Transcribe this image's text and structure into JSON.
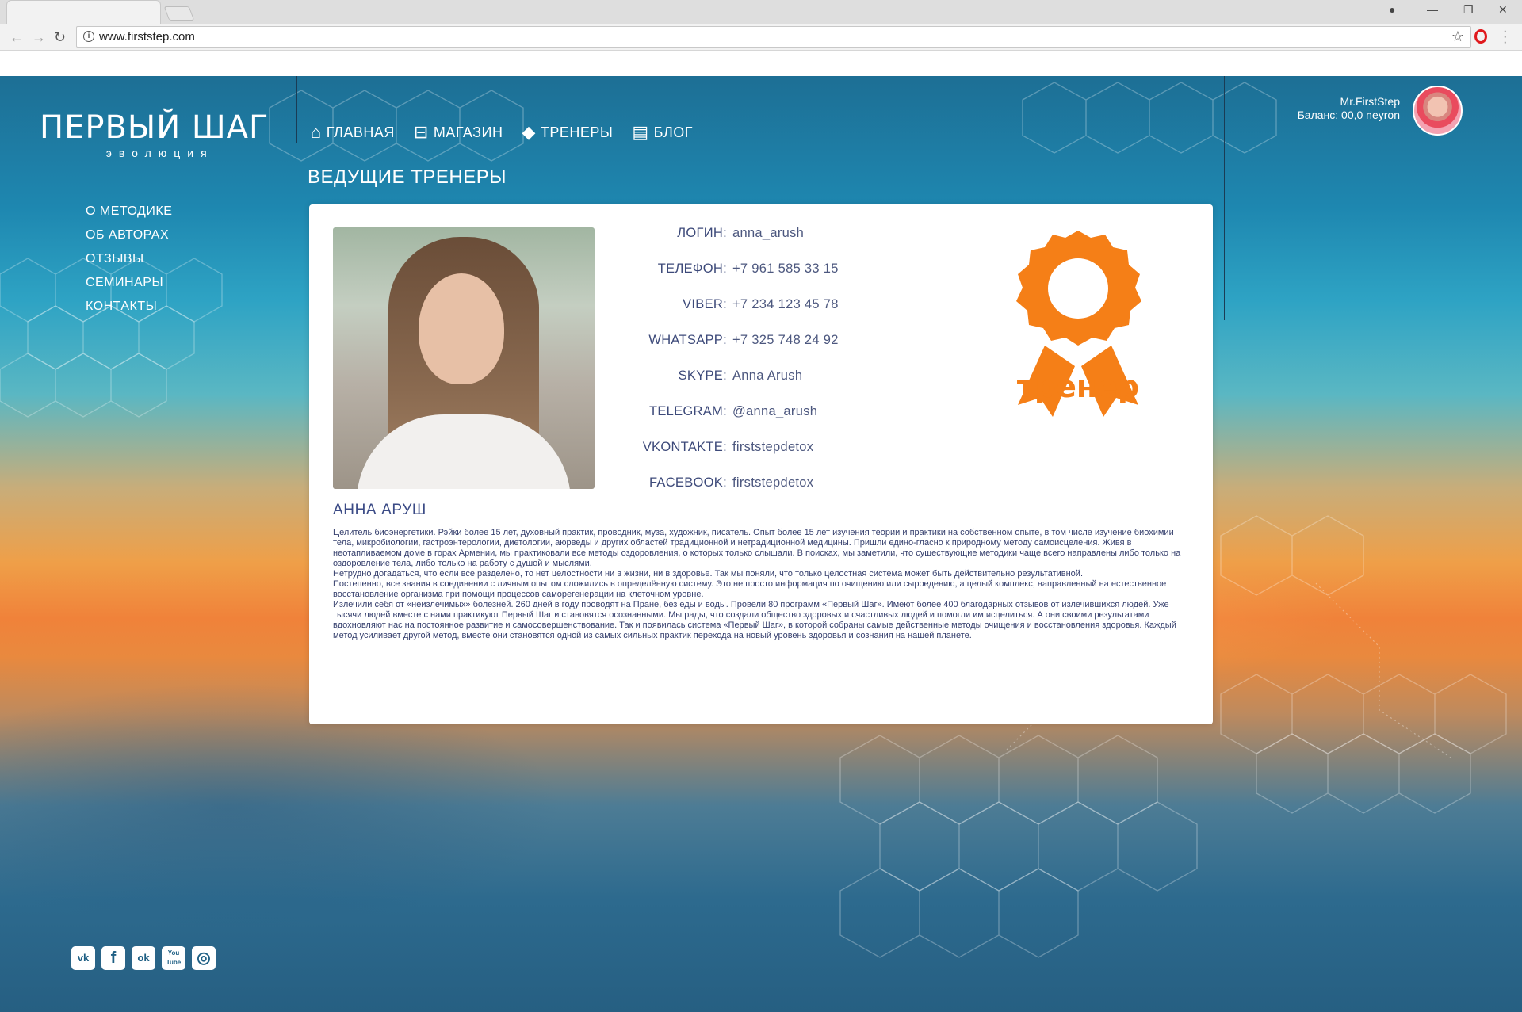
{
  "browser": {
    "url": "www.firststep.com"
  },
  "site": {
    "logo_title": "ПЕРВЫЙ ШАГ",
    "logo_subtitle": "эволюция",
    "nav": [
      {
        "label": "ГЛАВНАЯ",
        "icon": "home-icon"
      },
      {
        "label": "МАГАЗИН",
        "icon": "basket-icon"
      },
      {
        "label": "ТРЕНЕРЫ",
        "icon": "graduation-cap-icon"
      },
      {
        "label": "БЛОГ",
        "icon": "book-icon"
      }
    ],
    "user": {
      "name": "Mr.FirstStep",
      "balance": "Баланс: 00,0 neyron"
    },
    "side_menu": [
      "О МЕТОДИКЕ",
      "ОБ АВТОРАХ",
      "ОТЗЫВЫ",
      "СЕМИНАРЫ",
      "КОНТАКТЫ"
    ],
    "social": [
      {
        "label": "vk",
        "icon": "vk-icon"
      },
      {
        "label": "f",
        "icon": "facebook-icon"
      },
      {
        "label": "ok",
        "icon": "odnoklassniki-icon"
      },
      {
        "label": "You Tube",
        "icon": "youtube-icon"
      },
      {
        "label": "◎",
        "icon": "instagram-icon"
      }
    ]
  },
  "section_title": "ВЕДУЩИЕ ТРЕНЕРЫ",
  "trainer": {
    "name": "АННА АРУШ",
    "badge_text": "тренер",
    "badge_color": "#f57f17",
    "contacts": [
      {
        "key": "ЛОГИН:",
        "value": "anna_arush"
      },
      {
        "key": "ТЕЛЕФОН:",
        "value": "+7 961 585 33 15"
      },
      {
        "key": "VIBER:",
        "value": "+7 234 123 45 78"
      },
      {
        "key": "WHATSAPP:",
        "value": "+7 325 748 24 92"
      },
      {
        "key": "SKYPE:",
        "value": "Anna Arush"
      },
      {
        "key": "TELEGRAM:",
        "value": "@anna_arush"
      },
      {
        "key": "VKONTAKTE:",
        "value": "firststepdetox"
      },
      {
        "key": "FACEBOOK:",
        "value": "firststepdetox"
      }
    ],
    "bio": [
      "Целитель биоэнергетики. Рэйки более 15 лет, духовный практик, проводник, муза, художник, писатель. Опыт более 15 лет изучения теории и практики на собственном опыте, в том числе изучение биохимии тела, микробиологии, гастроэнтерологии, диетологии, аюрведы и других областей традиционной и нетрадиционной медицины. Пришли едино-гласно к природному методу самоисцеления. Живя в неотапливаемом доме в горах Армении, мы практиковали все методы оздоровления, о которых только слышали. В поисках, мы заметили, что существующие методики чаще всего направлены либо только на оздоровление тела, либо только на работу с душой и мыслями.",
      "Нетрудно догадаться, что если все разделено, то нет целостности ни в жизни, ни в здоровье. Так мы поняли, что только целостная система может быть действительно результативной.",
      "Постепенно, все знания в соединении с личным опытом сложились в определённую систему. Это не просто информация по очищению или сыроедению, а целый комплекс, направленный на естественное восстановление организма при помощи процессов саморегенерации на клеточном уровне.",
      "Излечили себя от «неизлечимых» болезней. 260 дней в году проводят на Пране, без еды и воды. Провели 80 программ «Первый Шаг». Имеют более 400 благодарных отзывов от излечившихся людей. Уже тысячи людей вместе с нами практикуют Первый Шаг и становятся осознанными. Мы рады, что создали общество здоровых и счастливых людей и помогли им исцелиться. А они своими результатами вдохновляют нас на постоянное развитие и самосовершенствование. Так и появилась система «Первый Шаг», в которой собраны самые действенные методы очищения и восстановления здоровья. Каждый метод усиливает другой метод, вместе они становятся одной из самых сильных практик перехода на новый уровень здоровья и сознания на нашей планете."
    ]
  }
}
